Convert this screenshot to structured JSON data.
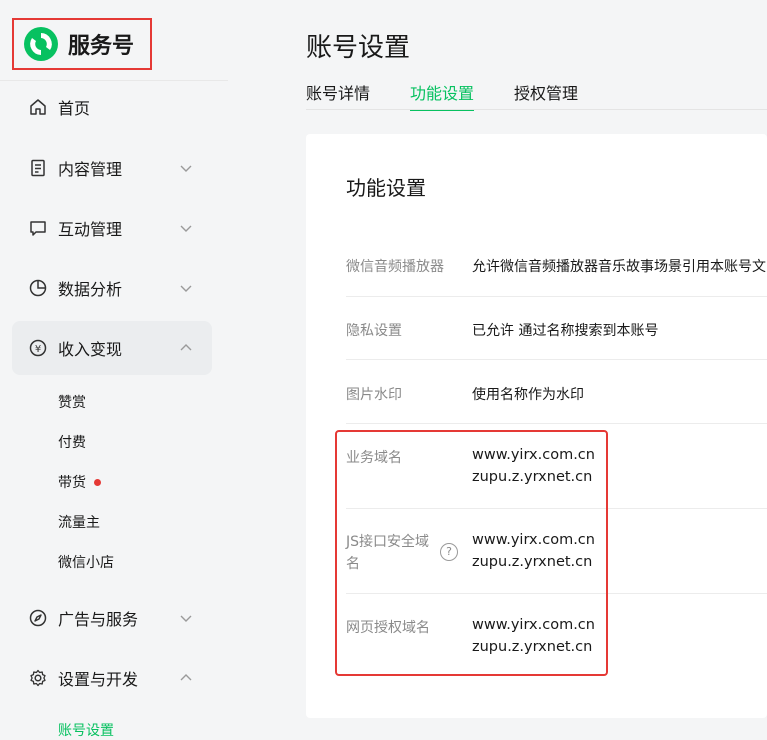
{
  "brand": {
    "name": "服务号"
  },
  "nav": {
    "items": [
      {
        "label": "首页",
        "icon": "home-icon"
      },
      {
        "label": "内容管理",
        "icon": "document-icon"
      },
      {
        "label": "互动管理",
        "icon": "chat-icon"
      },
      {
        "label": "数据分析",
        "icon": "pie-chart-icon"
      },
      {
        "label": "收入变现",
        "icon": "yen-icon"
      },
      {
        "label": "广告与服务",
        "icon": "compass-icon"
      },
      {
        "label": "设置与开发",
        "icon": "gear-icon"
      }
    ],
    "income_sub": [
      {
        "label": "赞赏"
      },
      {
        "label": "付费"
      },
      {
        "label": "带货"
      },
      {
        "label": "流量主"
      },
      {
        "label": "微信小店"
      }
    ],
    "settings_sub": [
      {
        "label": "账号设置"
      }
    ]
  },
  "page": {
    "title": "账号设置",
    "tabs": [
      {
        "label": "账号详情"
      },
      {
        "label": "功能设置"
      },
      {
        "label": "授权管理"
      }
    ]
  },
  "card": {
    "title": "功能设置",
    "rows": [
      {
        "label": "微信音频播放器",
        "value": "允许微信音频播放器音乐故事场景引用本账号文"
      },
      {
        "label": "隐私设置",
        "value": "已允许 通过名称搜索到本账号"
      },
      {
        "label": "图片水印",
        "value": "使用名称作为水印"
      },
      {
        "label": "业务域名",
        "values": [
          "www.yirx.com.cn",
          "zupu.z.yrxnet.cn"
        ]
      },
      {
        "label": "JS接口安全域名",
        "help": "?",
        "values": [
          "www.yirx.com.cn",
          "zupu.z.yrxnet.cn"
        ]
      },
      {
        "label": "网页授权域名",
        "values": [
          "www.yirx.com.cn",
          "zupu.z.yrxnet.cn"
        ]
      }
    ]
  },
  "colors": {
    "accent": "#07c160",
    "highlight": "#e53935",
    "badge": "#e53935"
  }
}
